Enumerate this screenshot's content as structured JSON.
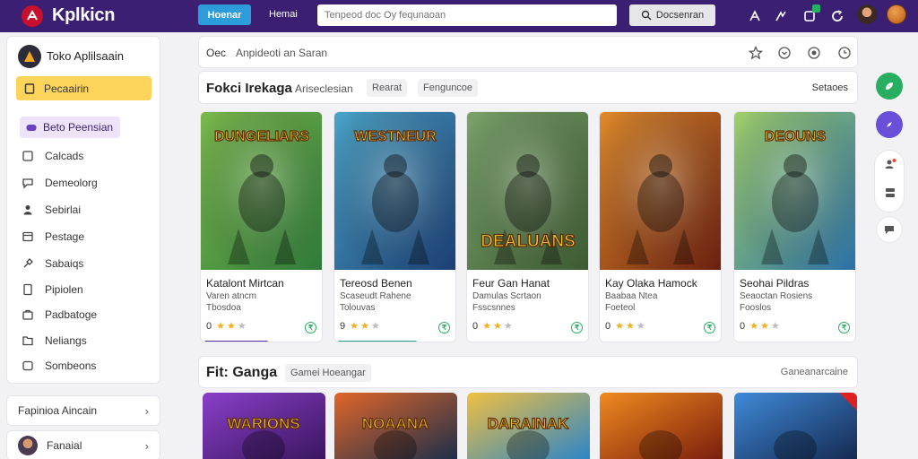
{
  "header": {
    "logo_text": "Kplkicn",
    "nav_active": "Hoenar",
    "nav_link": "Hemai",
    "search_placeholder": "Tenpeod doc Oy fequnaoan",
    "search_button": "Docsenran",
    "icons": [
      "tag-icon",
      "trend-icon",
      "bell-icon",
      "refresh-icon"
    ]
  },
  "sidebar": {
    "store_title": "Toko Aplilsaain",
    "active_item": "Pecaairin",
    "sub_item": "Beto Peensian",
    "items": [
      {
        "label": "Calcads",
        "icon": "tag-icon"
      },
      {
        "label": "Demeolorg",
        "icon": "chat-icon"
      },
      {
        "label": "Sebirlai",
        "icon": "user-icon"
      },
      {
        "label": "Pestage",
        "icon": "box-icon"
      },
      {
        "label": "Sabaiqs",
        "icon": "tools-icon"
      },
      {
        "label": "Pipiolen",
        "icon": "doc-icon"
      },
      {
        "label": "Padbatoge",
        "icon": "briefcase-icon"
      },
      {
        "label": "Neliangs",
        "icon": "folder-icon"
      },
      {
        "label": "Sombeons",
        "icon": "square-icon"
      }
    ],
    "bottom_1": "Fapinioa Aincain",
    "bottom_2": "Fanaial"
  },
  "breadcrumb": {
    "part_1": "Oec",
    "part_2": "Anpideoti an Saran"
  },
  "section_1": {
    "title": "Fokci Irekaga",
    "subtitle": "Ariseclesian",
    "chip_1": "Rearat",
    "chip_2": "Fenguncoe",
    "right_link": "Setaoes"
  },
  "cards": [
    {
      "title": "Katalont Mirtcan",
      "subtitle": "Varen atncm",
      "meta": "Tbosdoa",
      "rating_num": "0",
      "rating": 2,
      "banner": "DUNGELIARS",
      "color_a": "#2f7a3a",
      "color_b": "#7ab84c",
      "bar_color": "#5b2fa0",
      "bar_pct": 0.55
    },
    {
      "title": "Tereosd Benen",
      "subtitle": "Scaseudt Rahene",
      "meta": "Tolouvas",
      "rating_num": "9",
      "rating": 2,
      "banner": "WESTNEUR",
      "color_a": "#1b3e72",
      "color_b": "#4aa3c8",
      "bar_color": "#2a9d8f",
      "bar_pct": 0.68
    },
    {
      "title": "Feur Gan Hanat",
      "subtitle": "Damulas Scrtaon",
      "meta": "Fsscsnnes",
      "rating_num": "0",
      "rating": 2,
      "banner": "DEALUANS",
      "color_a": "#3d5a32",
      "color_b": "#7aa36a",
      "bar_color": "",
      "bar_pct": 0
    },
    {
      "title": "Kay Olaka Hamock",
      "subtitle": "Baabaa Ntea",
      "meta": "Foeteol",
      "rating_num": "0",
      "rating": 2,
      "banner": "",
      "color_a": "#6a1f10",
      "color_b": "#e08a2a",
      "bar_color": "",
      "bar_pct": 0
    },
    {
      "title": "Seohai Pildras",
      "subtitle": "Seaoctan Rosiens",
      "meta": "Fooslos",
      "rating_num": "0",
      "rating": 2,
      "banner": "DEOUNS",
      "color_a": "#2a6fa8",
      "color_b": "#9fd06a",
      "bar_color": "",
      "bar_pct": 0
    }
  ],
  "section_2": {
    "title": "Fit: Ganga",
    "chip": "Gamei Hoeangar",
    "right_link": "Ganeanarcaine"
  },
  "cards_row_2": [
    {
      "banner": "WARIONS",
      "color_a": "#3a1660",
      "color_b": "#8a3fc8"
    },
    {
      "banner": "NOAANA",
      "color_a": "#1d2f4a",
      "color_b": "#e0662a"
    },
    {
      "banner": "DARAINAK",
      "color_a": "#2c85c8",
      "color_b": "#f0c040"
    },
    {
      "banner": "",
      "color_a": "#7a1e0c",
      "color_b": "#f08a20"
    },
    {
      "banner": "",
      "color_a": "#152a52",
      "color_b": "#3f8ad8"
    }
  ],
  "fabs": [
    {
      "icon": "leaf-icon",
      "color": "#27ae60"
    },
    {
      "icon": "compass-icon",
      "color": "#6a4fd8"
    }
  ],
  "colors": {
    "topbar": "#3a1f73",
    "accent": "#2d9cdb",
    "highlight": "#fcd45a"
  }
}
